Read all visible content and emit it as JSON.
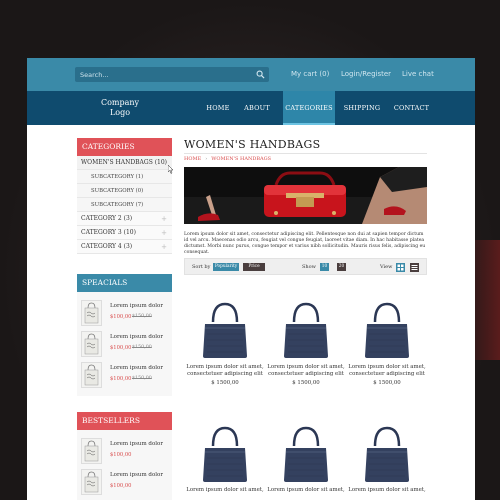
{
  "topbar": {
    "search_placeholder": "Search...",
    "cart": "My cart (0)",
    "login": "Login/Register",
    "livechat": "Live chat"
  },
  "logo": {
    "line1": "Company",
    "line2": "Logo"
  },
  "nav": {
    "items": [
      {
        "label": "HOME"
      },
      {
        "label": "ABOUT"
      },
      {
        "label": "CATEGORIES",
        "active": true
      },
      {
        "label": "SHIPPING"
      },
      {
        "label": "CONTACT"
      }
    ]
  },
  "sidebar": {
    "categories_title": "CATEGORIES",
    "categories": [
      {
        "label": "WOMEN'S HANDBAGS (10)",
        "type": "main"
      },
      {
        "label": "SUBCATEGORY (1)",
        "type": "sub"
      },
      {
        "label": "SUBCATEGORY (0)",
        "type": "sub"
      },
      {
        "label": "SUBCATEGORY (7)",
        "type": "sub"
      },
      {
        "label": "CATEGORY 2 (3)",
        "type": "main"
      },
      {
        "label": "CATEGORY 3 (10)",
        "type": "main"
      },
      {
        "label": "CATEGORY 4 (3)",
        "type": "main"
      }
    ],
    "specials_title": "SPEACIALS",
    "specials": [
      {
        "name": "Lorem ipsum dolor",
        "price": "$100,00",
        "old_price": "$150,00"
      },
      {
        "name": "Lorem ipsum dolor",
        "price": "$100,00",
        "old_price": "$150,00"
      },
      {
        "name": "Lorem ipsum dolor",
        "price": "$100,00",
        "old_price": "$150,00"
      }
    ],
    "bestsellers_title": "BESTSELLERS",
    "bestsellers": [
      {
        "name": "Lorem ipsum dolor",
        "price": "$100,00"
      },
      {
        "name": "Lorem ipsum dolor",
        "price": "$100,00"
      }
    ]
  },
  "main": {
    "title": "WOMEN'S HANDBAGS",
    "breadcrumb": [
      "HOME",
      "WOMEN'S HANDBAGS"
    ],
    "description": "Lorem ipsum dolor sit amet, consectetur adipiscing elit. Pellentesque non dui at sapien tempor dictum id vel arcu. Maecenas odio arcu, feugiat vel congue feugiat, laoreet vitae diam. In hac habitasse platea dictumst. Morbi nunc purus, congue tempor et varius nibh sollicitudin. Mauris risus felis, adipiscing eu consequat.",
    "toolbar": {
      "sort_label": "Sort by",
      "sort_popularity": "Popularity",
      "sort_price": "Price",
      "show_label": "Show",
      "show_10": "10",
      "show_20": "20",
      "view_label": "View"
    },
    "products": [
      {
        "name": "Lorem ipsum dolor sit amet, consectetuer adipiscing elit",
        "price": "$ 1500,00"
      },
      {
        "name": "Lorem ipsum dolor sit amet, consectetuer adipiscing elit",
        "price": "$ 1500,00"
      },
      {
        "name": "Lorem ipsum dolor sit amet, consectetuer adipiscing elit",
        "price": "$ 1500,00"
      },
      {
        "name": "Lorem ipsum dolor sit amet,",
        "price": ""
      },
      {
        "name": "Lorem ipsum dolor sit amet,",
        "price": ""
      },
      {
        "name": "Lorem ipsum dolor sit amet,",
        "price": ""
      }
    ]
  },
  "colors": {
    "topbar": "#3a8aa8",
    "navbar": "#0f4b6e",
    "accent_red": "#e05258",
    "accent_blue": "#3a8aa8",
    "bag": "#2f3d5e"
  }
}
